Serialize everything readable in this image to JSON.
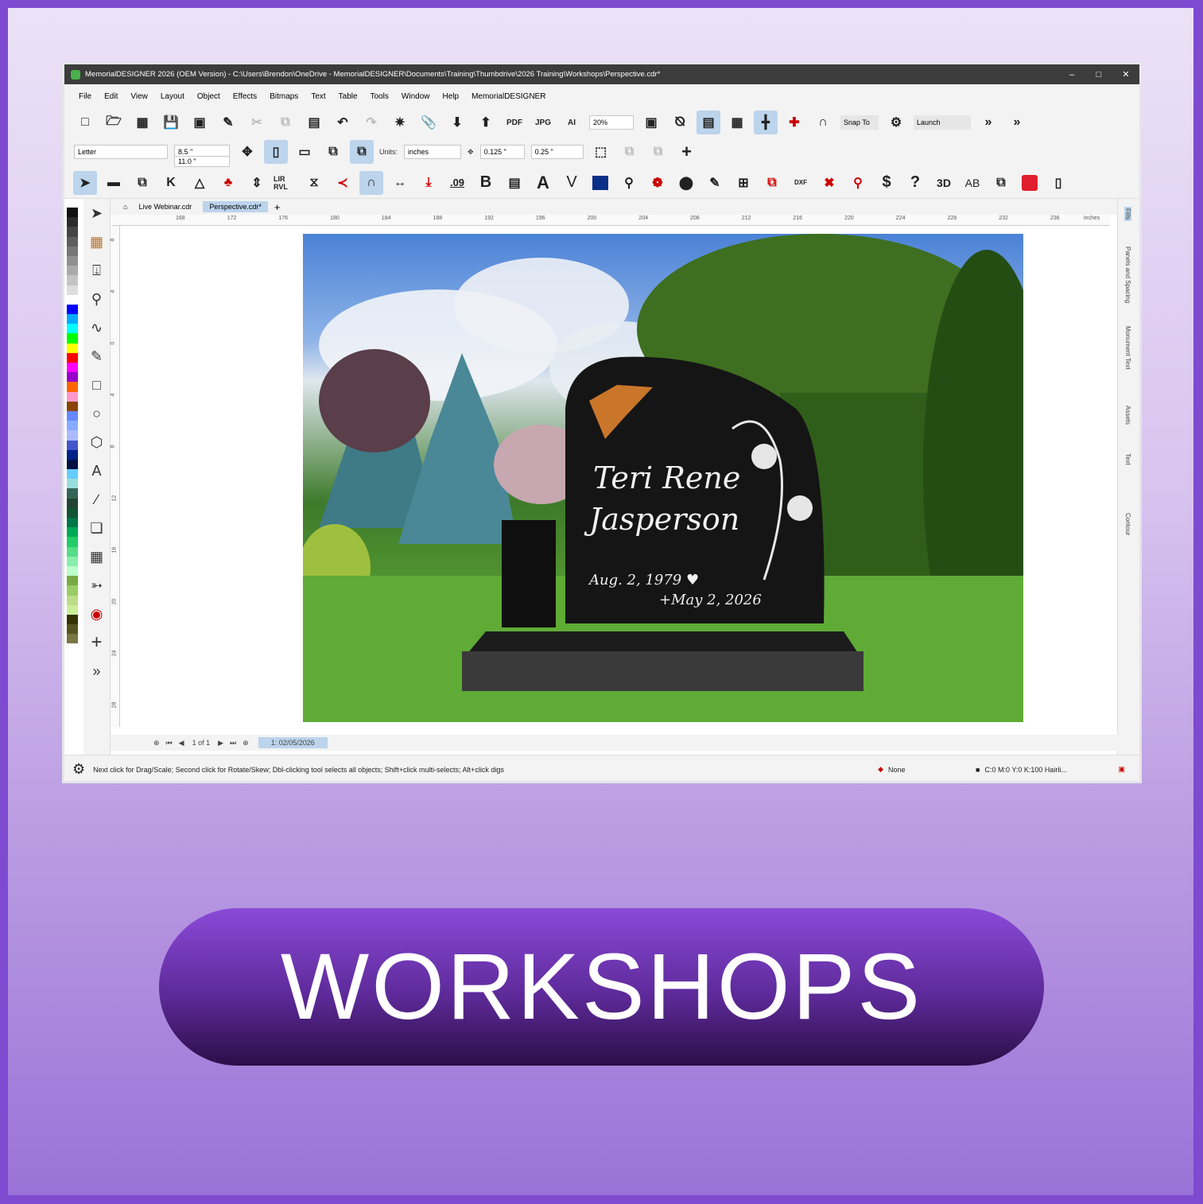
{
  "window": {
    "title": "MemorialDESIGNER 2026 (OEM Version) - C:\\Users\\Brendon\\OneDrive - MemorialDESIGNER\\Documents\\Training\\Thumbdrive\\2026 Training\\Workshops\\Perspective.cdr*"
  },
  "menu": [
    "File",
    "Edit",
    "View",
    "Layout",
    "Object",
    "Effects",
    "Bitmaps",
    "Text",
    "Table",
    "Tools",
    "Window",
    "Help",
    "MemorialDESIGNER"
  ],
  "toolbar": {
    "zoom": "20%",
    "snap": "Snap To",
    "launch": "Launch",
    "pdf": "PDF",
    "jpg": "JPG",
    "ai": "AI"
  },
  "propbar": {
    "page_size": "Letter",
    "width": "8.5 \"",
    "height": "11.0 \"",
    "units_label": "Units:",
    "units": "inches",
    "nudge": "0.125 \"",
    "dup_x": "0.25 \"",
    "dup_y": "0.25 \""
  },
  "tools3": {
    "lirrvl": "LIR RVL",
    "num": ".09",
    "bold": "B",
    "three_d": "3D",
    "ab": "AB",
    "dollar": "$",
    "question": "?",
    "dxf": "DXF"
  },
  "tabs": [
    "Live Webinar.cdr",
    "Perspective.cdr*"
  ],
  "ruler": {
    "unit": "inches",
    "h": [
      "168",
      "172",
      "176",
      "180",
      "184",
      "188",
      "192",
      "196",
      "200",
      "204",
      "208",
      "212",
      "216",
      "220",
      "224",
      "228",
      "232",
      "236"
    ],
    "v": [
      "8",
      "4",
      "0",
      "4",
      "8",
      "12",
      "16",
      "20",
      "24",
      "28"
    ]
  },
  "monument": {
    "name_line1": "Teri Rene",
    "name_line2": "Jasperson",
    "birth": "Aug. 2, 1979 ♥",
    "death": "+May 2, 2026"
  },
  "dock": [
    "Fills",
    "Panels and Spacing",
    "Monument Text",
    "Assets",
    "Text",
    "Contour"
  ],
  "pages": {
    "counter": "1 of 1",
    "page_tab": "1: 02/05/2026"
  },
  "status": {
    "hint": "Next click for Drag/Scale; Second click for Rotate/Skew; Dbl-clicking tool selects all objects; Shift+click multi-selects; Alt+click digs",
    "fill": "None",
    "outline": "C:0 M:0 Y:0 K:100  Hairli..."
  },
  "banner": "WORKSHOPS",
  "palette": [
    "#111111",
    "#2b2b2b",
    "#444444",
    "#5e5e5e",
    "#777777",
    "#909090",
    "#aaaaaa",
    "#c4c4c4",
    "#dddddd",
    "#ffffff",
    "#0000ff",
    "#00aaff",
    "#00ffff",
    "#00ff00",
    "#ffff00",
    "#ff0000",
    "#ff00ff",
    "#9900cc",
    "#ff6600",
    "#ff99cc",
    "#884400",
    "#6688ff",
    "#88aaff",
    "#aabbff",
    "#4455cc",
    "#002288",
    "#001144",
    "#66ccff",
    "#99dddd",
    "#336655",
    "#224433",
    "#115533",
    "#007744",
    "#00aa55",
    "#22cc66",
    "#55dd88",
    "#88eeaa",
    "#bbffcc",
    "#77aa44",
    "#99cc66",
    "#bbdd88",
    "#ccee99",
    "#333300",
    "#555522",
    "#777744"
  ]
}
